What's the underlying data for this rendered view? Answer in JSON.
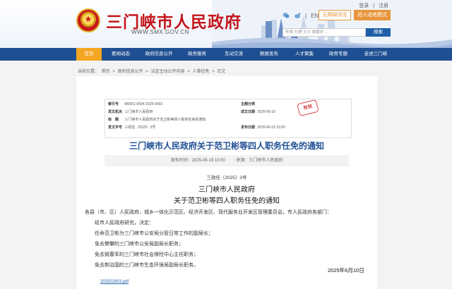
{
  "header": {
    "title": "三门峡市人民政府",
    "url": "WWW.SMX.GOV.CN",
    "top_links": {
      "login": "登录",
      "separator": "|",
      "register": "注册"
    },
    "util": {
      "separator": "|",
      "english": "EN"
    },
    "barrier_free": "无障碍浏览",
    "elder_mode": "进入适老模式",
    "search_placeholder": "年报  办理  天文 援藏扶 …",
    "search_button": "搜索"
  },
  "nav": {
    "items": [
      {
        "label": "首页"
      },
      {
        "label": "要闻动态"
      },
      {
        "label": "政府信息公开"
      },
      {
        "label": "政务服务"
      },
      {
        "label": "互动交流"
      },
      {
        "label": "数据发布"
      },
      {
        "label": "人才聚集"
      },
      {
        "label": "政务专题"
      },
      {
        "label": "走进三门峡"
      }
    ]
  },
  "breadcrumb": {
    "prefix": "当前位置：",
    "items": [
      "首页",
      "政府信息公开",
      "法定主动公开内容",
      "人事任免",
      "正文"
    ],
    "separator": ">"
  },
  "meta": {
    "index_label": "索引号",
    "index_value": "M0001-0004-2025-0003",
    "issuer_label": "发文机关",
    "issuer_value": "三门峡市人民政府",
    "title_label": "标　题",
    "title_value": "三门峡市人民政府关于范卫彬等四人职务任免的通知",
    "docno_label": "发文字号",
    "docno_value": "三政任〔2025〕3号",
    "category_label": "主题分类",
    "date_label": "成文日期",
    "date_value": "2025-06-10",
    "pubdate_label": "发布日期",
    "pubdate_value": "2025-06-19 15:50",
    "stamp": "有效"
  },
  "document": {
    "title": "三门峡市人民政府关于范卫彬等四人职务任免的通知",
    "pub_time": "发布时间：2025-06-19 15:50",
    "source": "来源：三门峡市人民政府",
    "doc_number": "三政任〔2025〕3号",
    "issuer": "三门峡市人民政府",
    "subtitle": "关于范卫彬等四人职务任免的通知",
    "salutation": "各县（市、区）人民政府，城乡一体化示范区、经济开发区、现代服务业开发区管理委员会，市人民政府各部门：",
    "paragraphs": [
      "经市人民政府研究，决定：",
      "任命范卫彬为三门峡市公安局分管日常工作的副局长；",
      "免去樊攀的三门峡市公安局副局长职务；",
      "免去姚春军的三门峡市社会保险中心主任职务；",
      "免去荆治国的三门峡市生态环境局副局长职务。"
    ],
    "date": "2025年6月10日",
    "attachment": "20255290​3.pdf"
  }
}
